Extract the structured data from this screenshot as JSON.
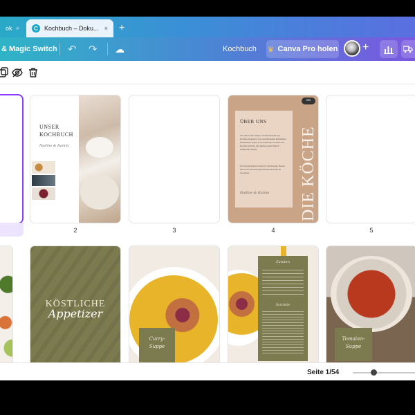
{
  "browser": {
    "tabs": [
      {
        "label": "ok",
        "close": "×"
      },
      {
        "label": "Kochbuch – Doku...",
        "close": "×",
        "favicon": "C"
      }
    ],
    "new_tab": "+"
  },
  "toolbar": {
    "magic_switch": "& Magic Switch",
    "undo_icon": "↶",
    "redo_icon": "↷",
    "cloud_icon": "☁",
    "doc_title": "Kochbuch",
    "pro_label": "Canva Pro holen",
    "crown_icon": "♛",
    "add_icon": "+",
    "chart_icon": "📊",
    "truck_icon": "🚚"
  },
  "pages": [
    {
      "number": "",
      "kind": "blank-selected"
    },
    {
      "number": "2",
      "title_1": "UNSER",
      "title_2": "KOCHBUCH",
      "script": "Nadine & Ramin"
    },
    {
      "number": "3",
      "kind": "blank"
    },
    {
      "number": "4",
      "heading": "ÜBER UNS",
      "para_1": "Wir teilen eine innige Leidenschaft für das Kochen. Inspiriert von verschiedenen kulturellen Erlebnissen zaubern wir köstliche Gerichte mit frischen Zutaten und häufig einem Hauch asiatischer Würze.",
      "para_2": "Wir modernisieren liebevoll die Rezepte meiner Oma, um den unvergleichlichen Aromen zu bewahren.",
      "script": "Nadine & Ramin",
      "vertical": "DIE KÖCHE",
      "menu": "•••"
    },
    {
      "number": "5",
      "kind": "blank"
    },
    {
      "number": "",
      "kind": "salad"
    },
    {
      "number": "",
      "title": "KÖSTLICHE",
      "script": "Appetizer"
    },
    {
      "number": "",
      "script_1": "Curry-",
      "script_2": "Suppe"
    },
    {
      "number": "",
      "heading_1": "Zutaten",
      "heading_2": "Schritte"
    },
    {
      "number": "",
      "script_1": "Tomaten-",
      "script_2": "Suppe"
    }
  ],
  "status": {
    "page_indicator": "Seite 1/54"
  },
  "colors": {
    "accent": "#8b3dff",
    "olive": "#7c7b4f",
    "tan": "#c9a487"
  }
}
